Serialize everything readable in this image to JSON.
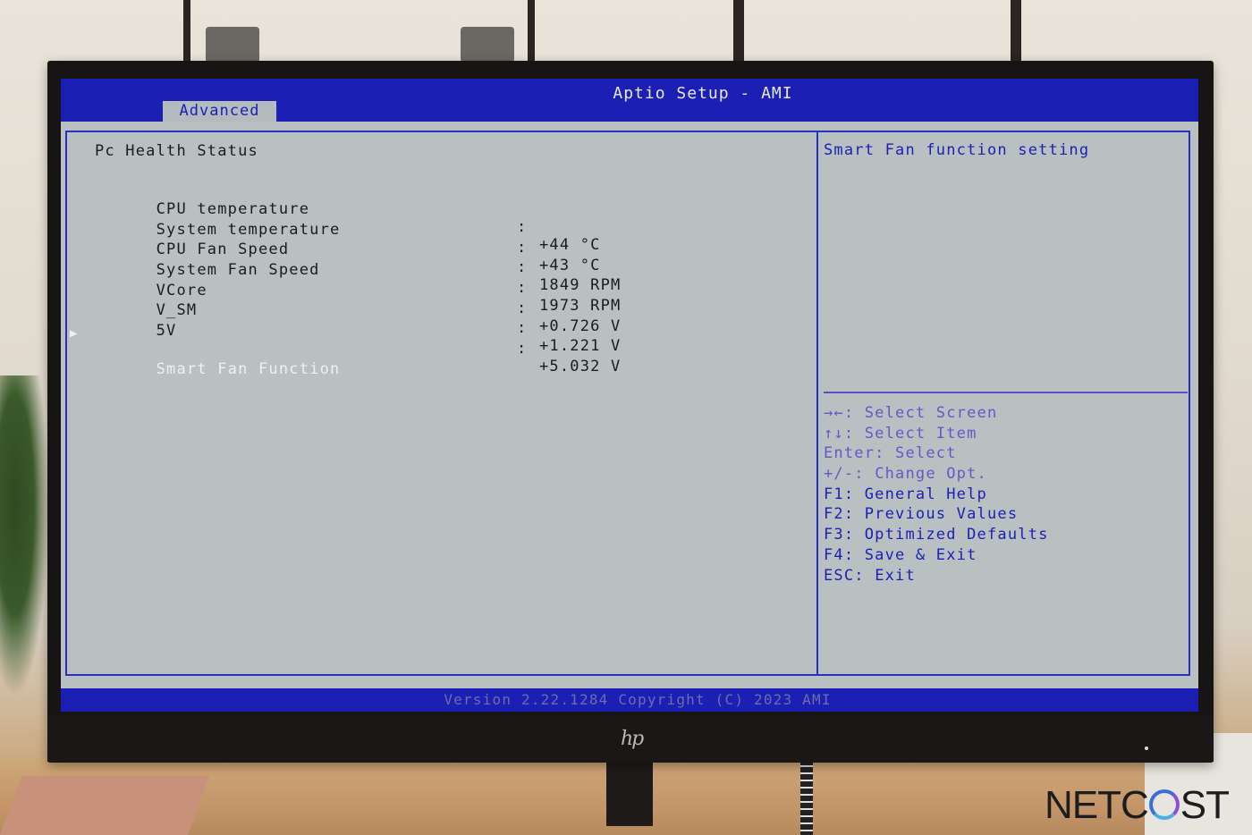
{
  "bios": {
    "title": "Aptio Setup - AMI",
    "active_tab": "Advanced",
    "section_heading": "Pc Health Status",
    "readings": [
      {
        "label": "CPU temperature",
        "value": "+44 °C"
      },
      {
        "label": "System temperature",
        "value": "+43 °C"
      },
      {
        "label": "CPU Fan Speed",
        "value": "1849 RPM"
      },
      {
        "label": "System Fan Speed",
        "value": "1973 RPM"
      },
      {
        "label": "VCore",
        "value": "+0.726 V"
      },
      {
        "label": "V_SM",
        "value": "+1.221 V"
      },
      {
        "label": "5V",
        "value": "+5.032 V"
      }
    ],
    "submenu": {
      "label": "Smart Fan Function",
      "arrow": "▶"
    },
    "help_text": "Smart Fan function setting",
    "key_help": [
      {
        "key": "→←:",
        "desc": "Select Screen"
      },
      {
        "key": "↑↓:",
        "desc": "Select Item"
      },
      {
        "key": "Enter:",
        "desc": "Select"
      },
      {
        "key": "+/-:",
        "desc": "Change Opt."
      },
      {
        "key": "F1:",
        "desc": "General Help"
      },
      {
        "key": "F2:",
        "desc": "Previous Values"
      },
      {
        "key": "F3:",
        "desc": "Optimized Defaults"
      },
      {
        "key": "F4:",
        "desc": "Save & Exit"
      },
      {
        "key": "ESC:",
        "desc": "Exit"
      }
    ],
    "version": "Version 2.22.1284 Copyright (C) 2023 AMI",
    "colon": ":"
  },
  "monitor": {
    "brand_logo": "hp"
  },
  "watermark": {
    "pre": "NETC",
    "post": "ST"
  },
  "colors": {
    "bios_blue": "#1b1fb4",
    "bios_grey": "#b9c0c2"
  }
}
